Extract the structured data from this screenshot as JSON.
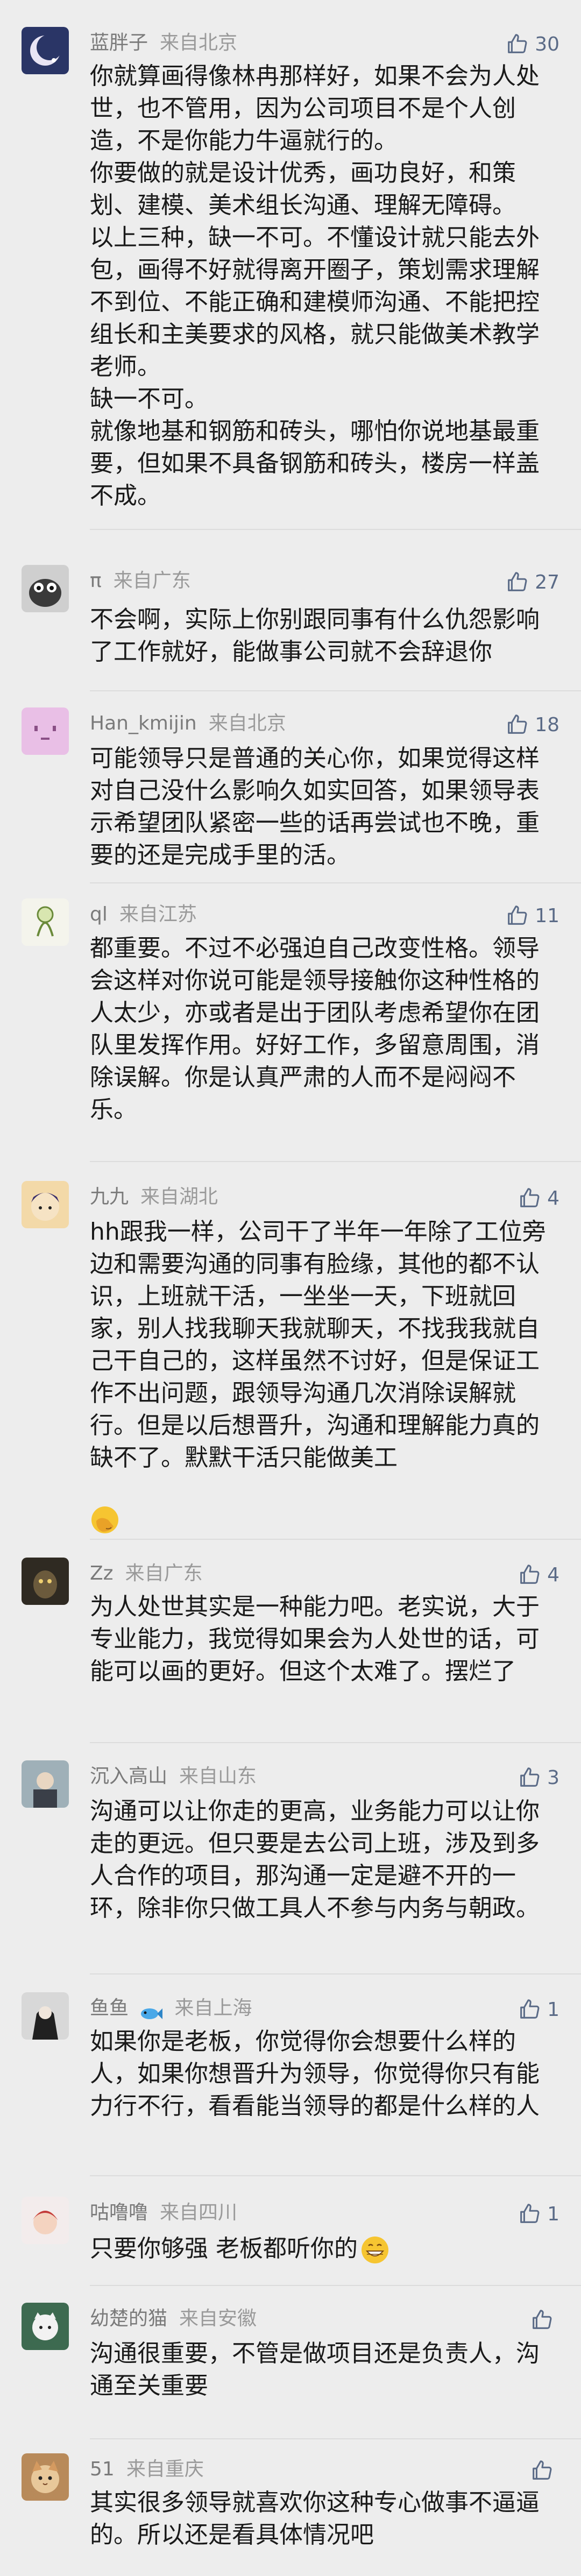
{
  "comments": [
    {
      "username": "蓝胖子",
      "location": "来自北京",
      "likes": "30",
      "text": "你就算画得像林冉那样好，如果不会为人处世，也不管用，因为公司项目不是个人创造，不是你能力牛逼就行的。\n你要做的就是设计优秀，画功良好，和策划、建模、美术组长沟通、理解无障碍。\n以上三种，缺一不可。不懂设计就只能去外包，画得不好就得离开圈子，策划需求理解不到位、不能正确和建模师沟通、不能把控组长和主美要求的风格，就只能做美术教学老师。\n缺一不可。\n就像地基和钢筋和砖头，哪怕你说地基最重要，但如果不具备钢筋和砖头，楼房一样盖不成。"
    },
    {
      "username": "π",
      "location": "来自广东",
      "likes": "27",
      "text": "不会啊，实际上你别跟同事有什么仇怨影响了工作就好，能做事公司就不会辞退你"
    },
    {
      "username": "Han_kmijin",
      "location": "来自北京",
      "likes": "18",
      "text": "可能领导只是普通的关心你，如果觉得这样对自己没什么影响久如实回答，如果领导表示希望团队紧密一些的话再尝试也不晚，重要的还是完成手里的活。"
    },
    {
      "username": "ql",
      "location": "来自江苏",
      "likes": "11",
      "text": "都重要。不过不必强迫自己改变性格。领导会这样对你说可能是领导接触你这种性格的人太少，亦或者是出于团队考虑希望你在团队里发挥作用。好好工作，多留意周围，消除误解。你是认真严肃的人而不是闷闷不乐。"
    },
    {
      "username": "九九",
      "location": "来自湖北",
      "likes": "4",
      "text": "hh跟我一样，公司干了半年一年除了工位旁边和需要沟通的同事有脸缘，其他的都不认识，上班就干活，一坐坐一天，下班就回家，别人找我聊天我就聊天，不找我我就自己干自己的，这样虽然不讨好，但是保证工作不出问题，跟领导沟通几次消除误解就行。但是以后想晋升，沟通和理解能力真的缺不了。默默干活只能做美工"
    },
    {
      "username": "Zz",
      "location": "来自广东",
      "likes": "4",
      "text": "为人处世其实是一种能力吧。老实说，大于专业能力，我觉得如果会为人处世的话，可能可以画的更好。但这个太难了。摆烂了"
    },
    {
      "username": "沉入高山",
      "location": "来自山东",
      "likes": "3",
      "text": "沟通可以让你走的更高，业务能力可以让你走的更远。但只要是去公司上班，涉及到多人合作的项目，那沟通一定是避不开的一环，除非你只做工具人不参与内务与朝政。"
    },
    {
      "username": "鱼鱼",
      "location": "来自上海",
      "likes": "1",
      "text": "如果你是老板，你觉得你会想要什么样的人，如果你想晋升为领导，你觉得你只有能力行不行，看看能当领导的都是什么样的人"
    },
    {
      "username": "咕噜噜",
      "location": "来自四川",
      "likes": "1",
      "text": "只要你够强 老板都听你的"
    },
    {
      "username": "幼楚的猫",
      "location": "来自安徽",
      "likes": "",
      "text": "沟通很重要，不管是做项目还是负责人，沟通至关重要"
    },
    {
      "username": "51",
      "location": "来自重庆",
      "likes": "",
      "text": "其实很多领导就喜欢你这种专心做事不逼逼的。所以还是看具体情况吧"
    }
  ],
  "icons": {
    "like": "thumbs-up-icon",
    "emoji_facepalm": "facepalm-emoji-icon",
    "emoji_grin": "grinning-emoji-icon",
    "fish": "fish-emoji-icon"
  },
  "colors": {
    "background": "#ededed",
    "username": "#7a7a7a",
    "text": "#1a1a1a",
    "like": "#5b6b87"
  }
}
